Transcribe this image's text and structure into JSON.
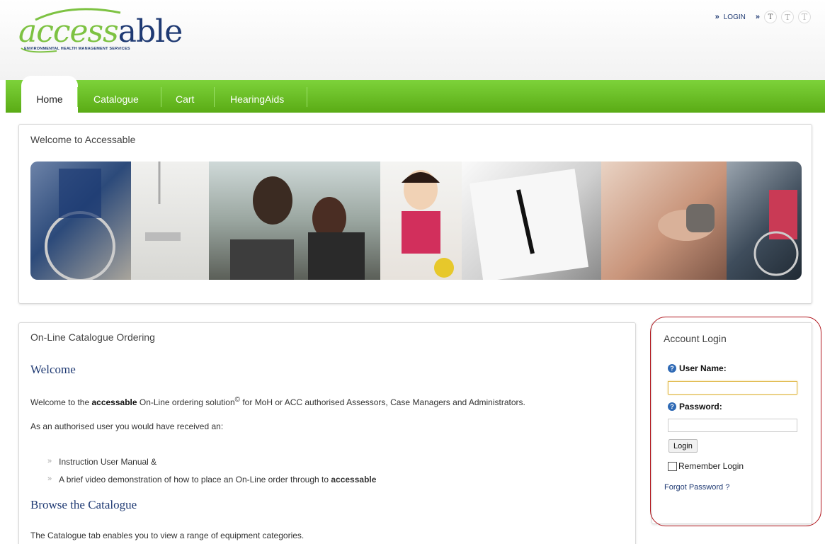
{
  "header": {
    "logo": {
      "part1": "access",
      "part2": "able",
      "tagline": "ENVIRONMENTAL HEALTH MANAGEMENT SERVICES"
    },
    "top_links": {
      "login_label": "LOGIN",
      "text_size_labels": [
        "T",
        "T",
        "T"
      ]
    }
  },
  "nav": {
    "tabs": [
      {
        "label": "Home",
        "active": true
      },
      {
        "label": "Catalogue",
        "active": false
      },
      {
        "label": "Cart",
        "active": false
      },
      {
        "label": "HearingAids",
        "active": false
      }
    ]
  },
  "welcome_panel": {
    "title": "Welcome to Accessable"
  },
  "catalogue_panel": {
    "title": "On-Line Catalogue Ordering",
    "welcome_heading": "Welcome",
    "intro_pre": "Welcome to the ",
    "intro_brand": "accessable",
    "intro_mid": " On-Line ordering solution",
    "intro_sup": "©",
    "intro_post": " for MoH or ACC authorised Assessors, Case Managers and Administrators.",
    "received_text": "As an authorised user you would have received an:",
    "bullets": [
      {
        "text": "Instruction User Manual &"
      },
      {
        "text_pre": "A brief video demonstration of how to place an On-Line order through to ",
        "text_brand": "accessable"
      }
    ],
    "browse_heading": "Browse the Catalogue",
    "browse_text": "The Catalogue tab enables you to view a range of equipment categories."
  },
  "login_panel": {
    "title": "Account Login",
    "username_label": "User Name:",
    "username_value": "",
    "password_label": "Password:",
    "password_value": "",
    "login_button": "Login",
    "remember_label": "Remember Login",
    "remember_checked": false,
    "forgot_link": "Forgot Password ?"
  },
  "colors": {
    "nav_green": "#6cc22a",
    "brand_navy": "#1f3a73",
    "brand_green": "#7dc242",
    "highlight_red": "#b0151c"
  }
}
